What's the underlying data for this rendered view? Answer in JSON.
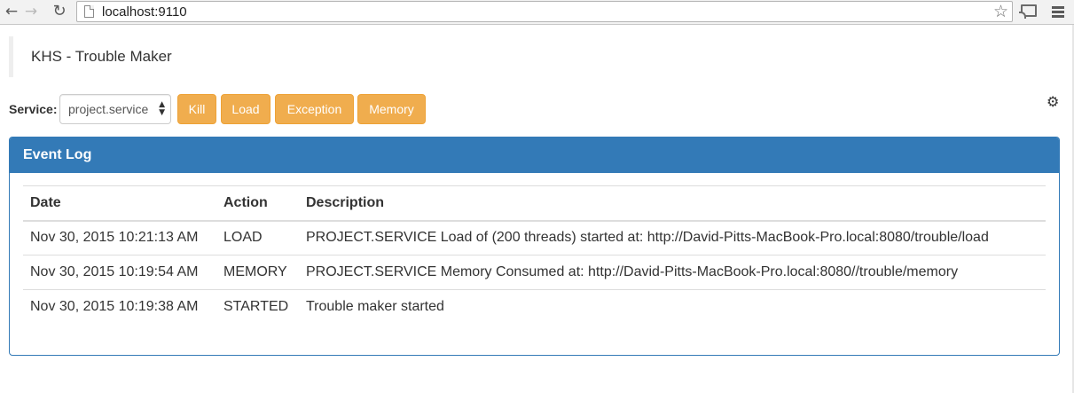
{
  "browser": {
    "url": "localhost:9110",
    "back_icon": "←",
    "forward_icon": "→",
    "reload_icon": "↻",
    "star_icon": "☆"
  },
  "page": {
    "title": "KHS - Trouble Maker"
  },
  "toolbar": {
    "service_label": "Service:",
    "service_selected": "project.service",
    "buttons": {
      "kill": "Kill",
      "load": "Load",
      "exception": "Exception",
      "memory": "Memory"
    },
    "button_color": "#f0ad4e",
    "settings_icon": "gear-icon"
  },
  "event_log": {
    "heading": "Event Log",
    "heading_color": "#337ab7",
    "columns": [
      "Date",
      "Action",
      "Description"
    ],
    "rows": [
      {
        "date": "Nov 30, 2015 10:21:13 AM",
        "action": "LOAD",
        "description": "PROJECT.SERVICE Load of (200 threads) started at: http://David-Pitts-MacBook-Pro.local:8080/trouble/load"
      },
      {
        "date": "Nov 30, 2015 10:19:54 AM",
        "action": "MEMORY",
        "description": "PROJECT.SERVICE Memory Consumed at: http://David-Pitts-MacBook-Pro.local:8080//trouble/memory"
      },
      {
        "date": "Nov 30, 2015 10:19:38 AM",
        "action": "STARTED",
        "description": "Trouble maker started"
      }
    ]
  }
}
